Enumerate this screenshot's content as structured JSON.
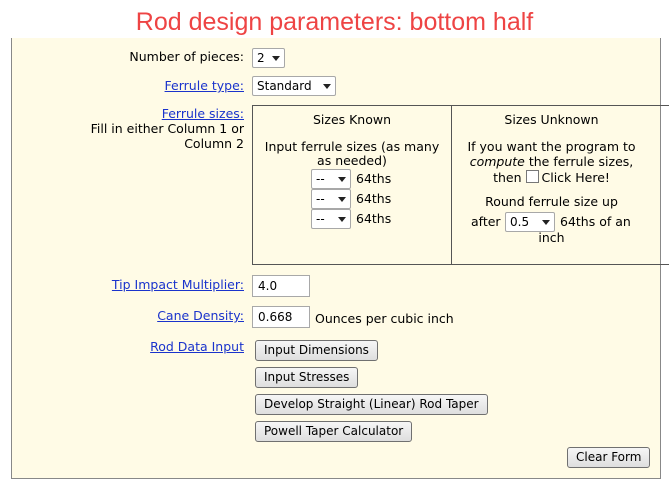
{
  "banner": "Rod design parameters: bottom half",
  "pieces": {
    "label": "Number of pieces:",
    "value": "2"
  },
  "ferrule_type": {
    "label": "Ferrule type:",
    "value": "Standard"
  },
  "ferrule_sizes": {
    "label": "Ferrule sizes:",
    "hint_line1": "Fill in either Column 1 or",
    "hint_line2": "Column 2",
    "known": {
      "header": "Sizes Known",
      "instr_line1": "Input ferrule sizes (as many",
      "instr_line2": "as needed)",
      "rows": [
        {
          "value": "--",
          "unit": "64ths"
        },
        {
          "value": "--",
          "unit": "64ths"
        },
        {
          "value": "--",
          "unit": "64ths"
        }
      ]
    },
    "unknown": {
      "header": "Sizes Unknown",
      "line1": "If you want the program to",
      "line2_em": "compute",
      "line2_rest": " the ferrule sizes,",
      "then": "then",
      "checkbox_label": "Click Here!",
      "round_line1": "Round ferrule size up",
      "after": "after",
      "round_value": "0.5",
      "round_unit": "64ths of an",
      "round_tail": "inch"
    }
  },
  "tip_impact": {
    "label": "Tip Impact Multiplier:",
    "value": "4.0"
  },
  "cane_density": {
    "label": "Cane Density:",
    "value": "0.668",
    "unit": "Ounces per cubic inch"
  },
  "rod_data": {
    "label": "Rod Data Input",
    "buttons": [
      "Input Dimensions",
      "Input Stresses",
      "Develop Straight (Linear) Rod Taper",
      "Powell Taper Calculator"
    ]
  },
  "clear_form": "Clear Form"
}
